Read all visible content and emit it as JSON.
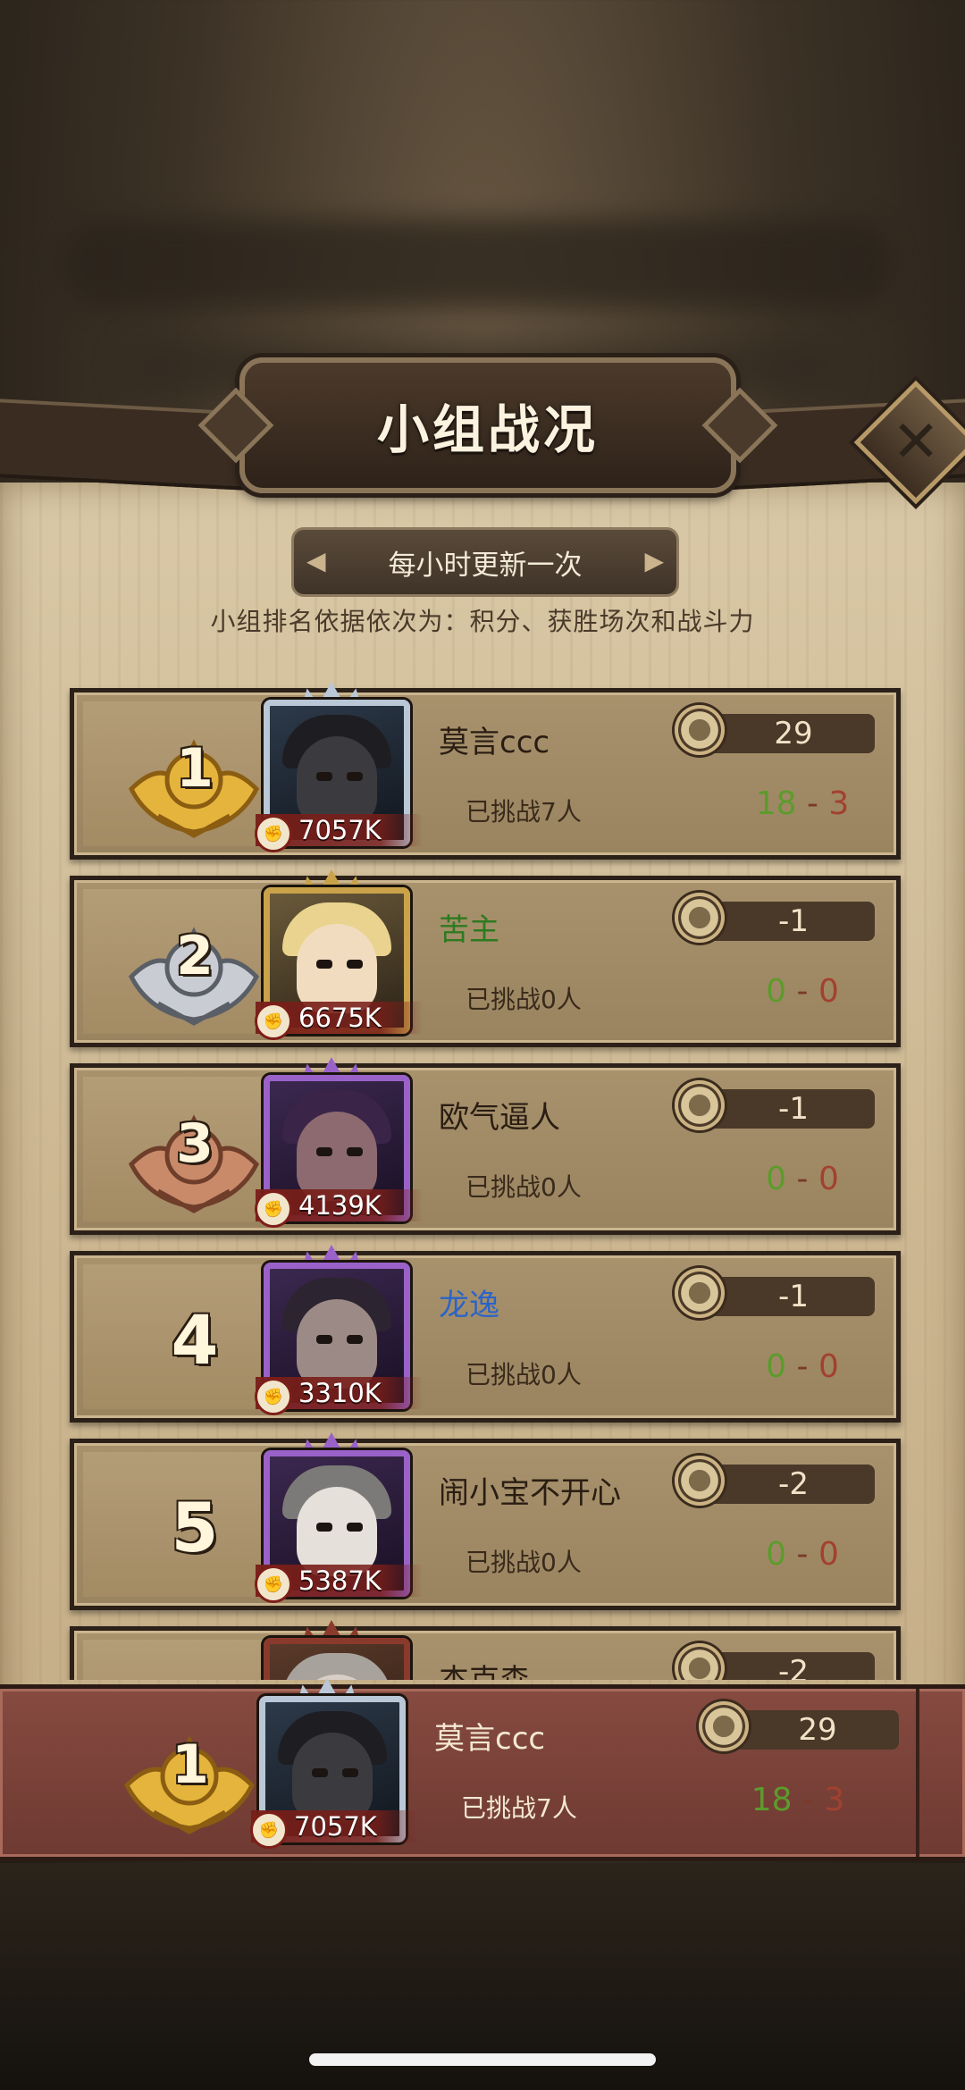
{
  "title": "小组战况",
  "refresh_notice": "每小时更新一次",
  "ranking_rule": "小组排名依据依次为：积分、获胜场次和战斗力",
  "challenged_prefix": "已挑战",
  "rows": [
    {
      "rank": "1",
      "medal": "gold",
      "name": "莫言ccc",
      "name_color": "default",
      "power": "7057K",
      "score": "29",
      "challenged": "已挑战7人",
      "wins": "18",
      "losses": "3"
    },
    {
      "rank": "2",
      "medal": "silver",
      "name": "苦主",
      "name_color": "green",
      "power": "6675K",
      "score": "-1",
      "challenged": "已挑战0人",
      "wins": "0",
      "losses": "0"
    },
    {
      "rank": "3",
      "medal": "bronze",
      "name": "欧气逼人",
      "name_color": "default",
      "power": "4139K",
      "score": "-1",
      "challenged": "已挑战0人",
      "wins": "0",
      "losses": "0"
    },
    {
      "rank": "4",
      "medal": "none",
      "name": "龙逸",
      "name_color": "blue",
      "power": "3310K",
      "score": "-1",
      "challenged": "已挑战0人",
      "wins": "0",
      "losses": "0"
    },
    {
      "rank": "5",
      "medal": "none",
      "name": "闹小宝不开心",
      "name_color": "default",
      "power": "5387K",
      "score": "-2",
      "challenged": "已挑战0人",
      "wins": "0",
      "losses": "0"
    },
    {
      "rank": "",
      "medal": "none",
      "name": "杰克森",
      "name_color": "default",
      "power": "",
      "score": "-2",
      "challenged": "",
      "wins": "",
      "losses": ""
    }
  ],
  "my_row": {
    "rank": "1",
    "medal": "gold",
    "name": "莫言ccc",
    "power": "7057K",
    "score": "29",
    "challenged": "已挑战7人",
    "wins": "18",
    "losses": "3"
  },
  "colors": {
    "gold": "#e5b43c",
    "silver": "#c9ccd2",
    "bronze": "#c98a6a",
    "win_green": "#5c9b2c",
    "loss_red": "#a2412f",
    "pinned_bg": "#864a40"
  },
  "icons": {
    "close": "close-x-icon",
    "score": "score-emblem-icon",
    "power": "fist-icon"
  }
}
